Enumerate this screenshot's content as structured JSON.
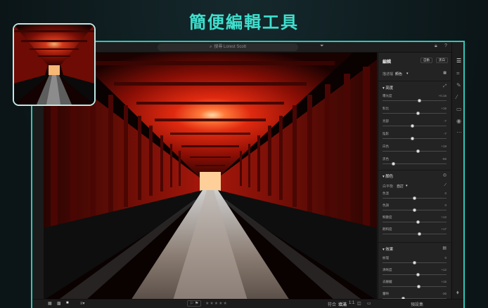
{
  "headline": "簡便編輯工具",
  "topbar": {
    "search_placeholder": "搜尋 Lorest Scott"
  },
  "panel": {
    "title": "編輯",
    "btn_auto": "自動",
    "btn_bw": "黑白",
    "profile_label": "描述檔",
    "profile_value": "顏色",
    "light": {
      "title": "亮度",
      "sliders": [
        {
          "label": "曝光度",
          "value": "+0.16",
          "pos": 0.58
        },
        {
          "label": "對比",
          "value": "+16",
          "pos": 0.55
        },
        {
          "label": "亮部",
          "value": "-7",
          "pos": 0.47
        },
        {
          "label": "陰影",
          "value": "-7",
          "pos": 0.47
        },
        {
          "label": "白色",
          "value": "+18",
          "pos": 0.56
        },
        {
          "label": "黑色",
          "value": "-66",
          "pos": 0.17
        }
      ]
    },
    "color": {
      "title": "顏色",
      "wb_label": "白平衡",
      "wb_value": "自訂",
      "sliders": [
        {
          "label": "色溫",
          "value": "0",
          "pos": 0.5
        },
        {
          "label": "色調",
          "value": "0",
          "pos": 0.5
        },
        {
          "label": "鮮艷度",
          "value": "+12",
          "pos": 0.56
        },
        {
          "label": "飽和度",
          "value": "+17",
          "pos": 0.58
        }
      ]
    },
    "effects": {
      "title": "效果",
      "sliders": [
        {
          "label": "紋理",
          "value": "0",
          "pos": 0.5
        },
        {
          "label": "清晰度",
          "value": "+12",
          "pos": 0.56
        },
        {
          "label": "去朦朧",
          "value": "+15",
          "pos": 0.57
        },
        {
          "label": "暈映",
          "value": "-35",
          "pos": 0.32
        }
      ]
    }
  },
  "bottombar": {
    "fit_label": "符合",
    "fill_label": "填滿",
    "ratio_label": "1:1",
    "presets_label": "預設集"
  },
  "colors": {
    "accent": "#3fe0cf",
    "frame": "#2fc6b8"
  }
}
